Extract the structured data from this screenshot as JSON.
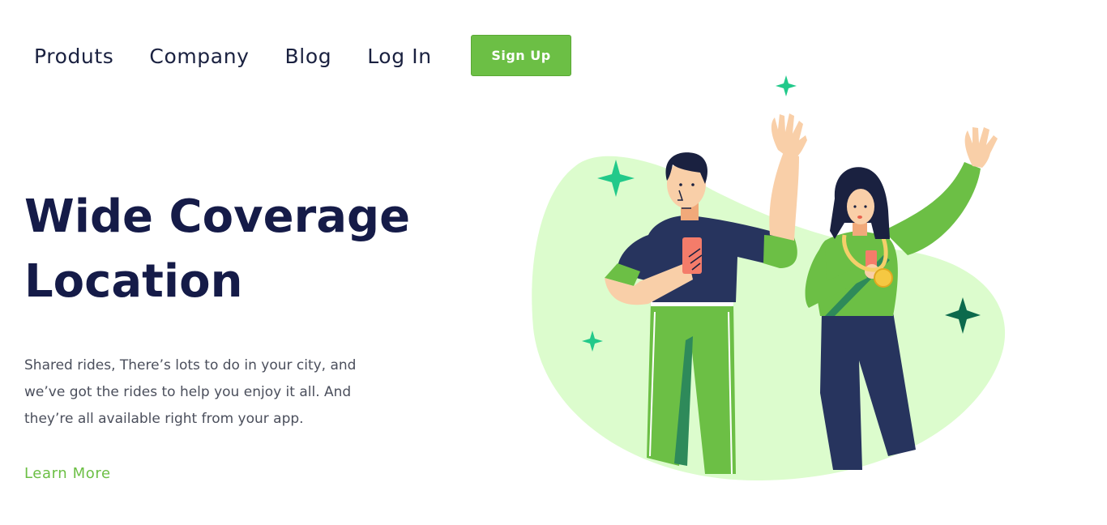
{
  "nav": {
    "items": [
      {
        "label": "Produts"
      },
      {
        "label": "Company"
      },
      {
        "label": "Blog"
      },
      {
        "label": "Log In"
      }
    ],
    "signup_label": "Sign Up"
  },
  "hero": {
    "title_line1": "Wide Coverage",
    "title_line2": "Location",
    "description_line1": "Shared rides, There’s lots to do in your city, and",
    "description_line2": "we’ve got the rides to help you enjoy it all. And",
    "description_line3": "they’re all available right from your app.",
    "cta_label": "Learn More"
  },
  "colors": {
    "accent": "#6cbf45",
    "heading": "#151b48",
    "text": "#4b4f5c",
    "blob": "#dcfccd",
    "navy": "#27345e",
    "sparkle": "#22c98a",
    "sparkle_dark": "#0c6a4c"
  },
  "illustration": {
    "icon": "people-waving-illustration"
  }
}
